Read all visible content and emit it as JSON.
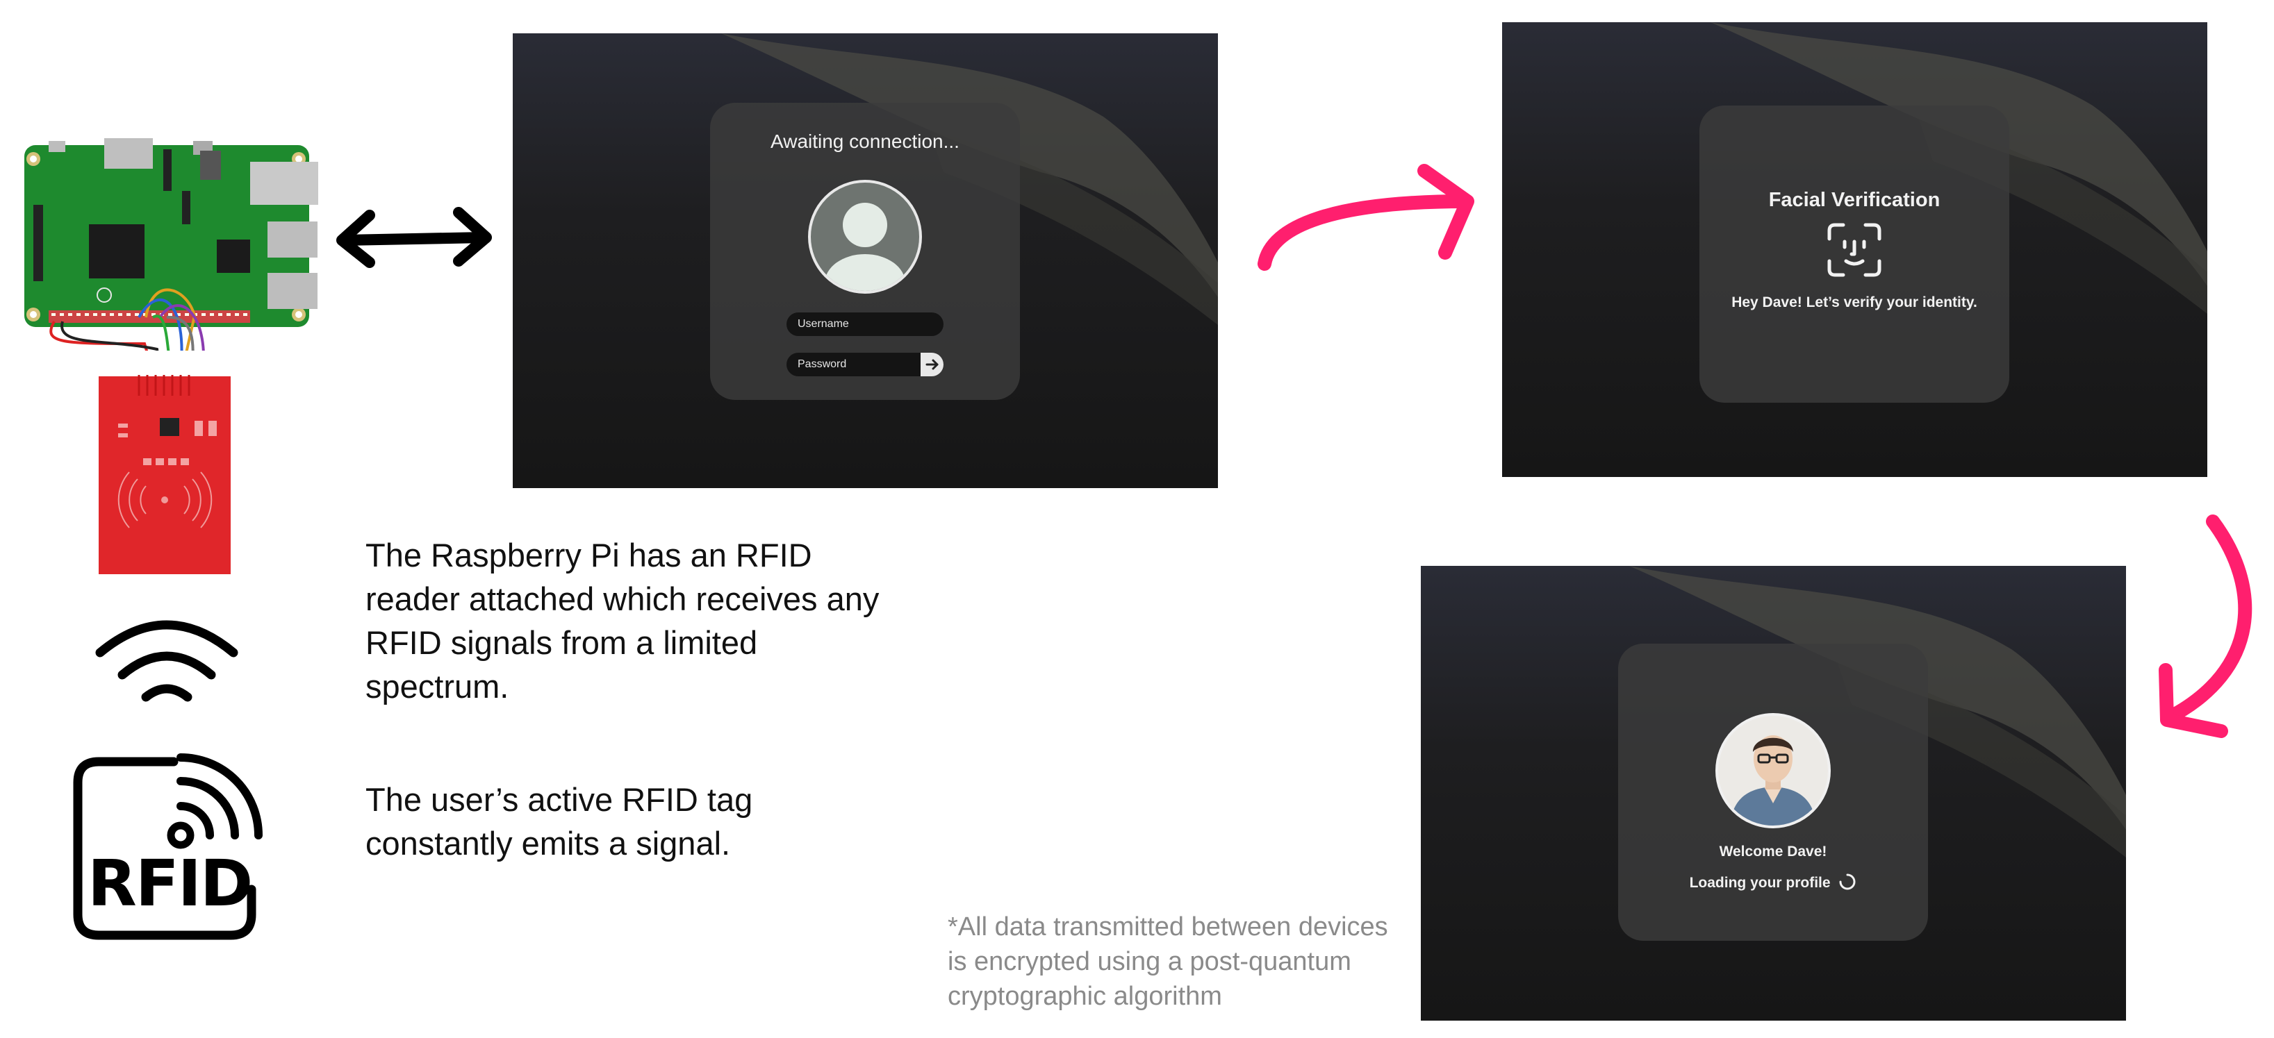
{
  "login_screen": {
    "status": "Awaiting connection...",
    "username_placeholder": "Username",
    "password_placeholder": "Password"
  },
  "verify_screen": {
    "title": "Facial Verification",
    "message": "Hey Dave! Let’s verify your identity."
  },
  "welcome_screen": {
    "title": "Welcome Dave!",
    "loading": "Loading your profile"
  },
  "descriptions": {
    "rfid_reader": "The Raspberry Pi has an RFID reader attached which receives any RFID signals from a limited spectrum.",
    "rfid_tag": "The user’s active RFID tag constantly emits a signal.",
    "encryption_note": "*All data transmitted between devices is encrypted using a post-quantum cryptographic algorithm"
  },
  "rfid_logo_text": "RFID",
  "colors": {
    "arrow_pink": "#ff1f6e",
    "board_green": "#1e8a2e",
    "rfid_red": "#e0262a",
    "screen_bg": "#1c1c1c",
    "card_bg": "#3c3c3c"
  },
  "icons": [
    "raspberry-pi-board",
    "rfid-reader-module",
    "wifi-signal-icon",
    "rfid-tag-icon",
    "user-avatar-icon",
    "arrow-right-icon",
    "face-id-icon",
    "loading-spinner-icon"
  ]
}
